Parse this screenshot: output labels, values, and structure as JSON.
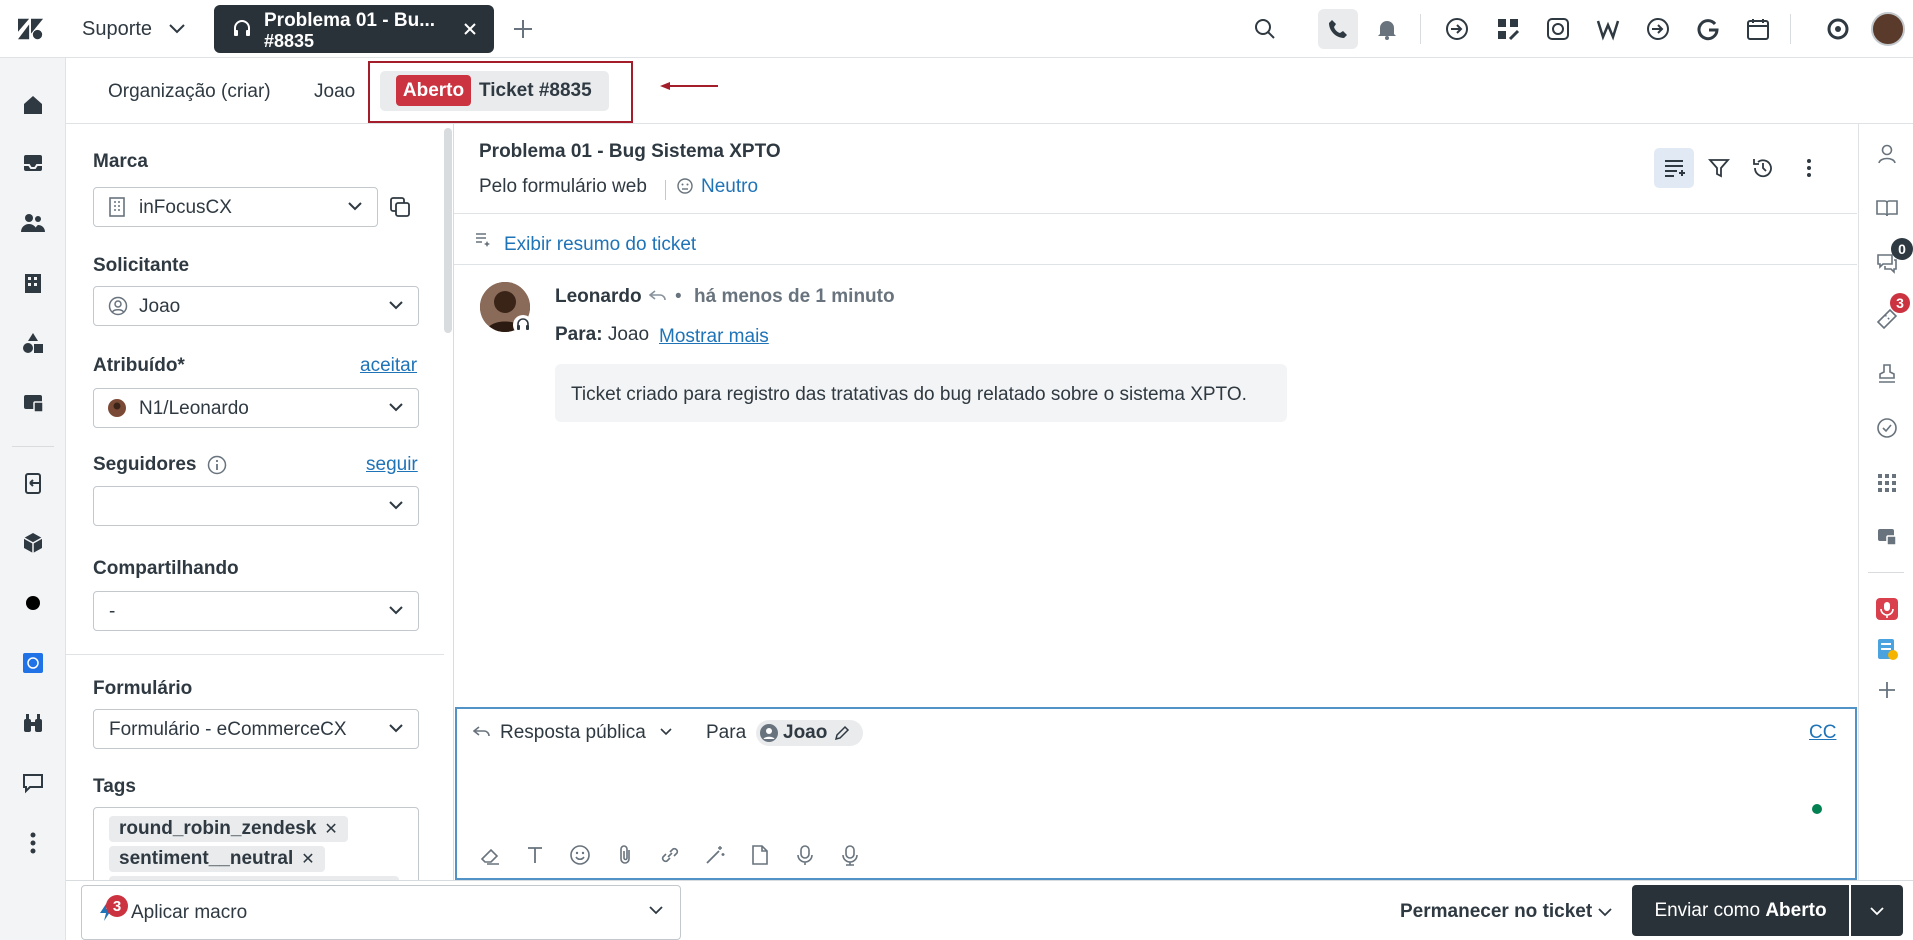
{
  "topbar": {
    "product": "Suporte",
    "tab_title": "Problema 01  - Bu...",
    "tab_subtitle": "#8835"
  },
  "context": {
    "org_link": "Organização (criar)",
    "user_link": "Joao",
    "status": "Aberto",
    "ticket_label": "Ticket #8835"
  },
  "fields": {
    "brand_label": "Marca",
    "brand_value": "inFocusCX",
    "requester_label": "Solicitante",
    "requester_value": "Joao",
    "assignee_label": "Atribuído*",
    "assignee_action": "aceitar",
    "assignee_value": "N1/Leonardo",
    "followers_label": "Seguidores",
    "followers_action": "seguir",
    "followers_value": "",
    "sharing_label": "Compartilhando",
    "sharing_value": "-",
    "form_label": "Formulário",
    "form_value": "Formulário - eCommerceCX",
    "tags_label": "Tags",
    "tags": [
      "round_robin_zendesk",
      "sentiment__neutral"
    ]
  },
  "conversation": {
    "title": "Problema 01  - Bug Sistema XPTO",
    "channel": "Pelo formulário web",
    "sentiment": "Neutro",
    "summary_link": "Exibir resumo do ticket",
    "message": {
      "author": "Leonardo",
      "time": "há menos de 1 minuto",
      "to_label": "Para:",
      "to_value": "Joao",
      "show_more": "Mostrar mais",
      "body": "Ticket criado para registro das tratativas do bug relatado sobre o sistema XPTO."
    }
  },
  "composer": {
    "reply_type": "Resposta pública",
    "to_label": "Para",
    "recipient": "Joao",
    "cc_label": "CC"
  },
  "rail": {
    "conversations_count": "0",
    "tickets_count": "3"
  },
  "footer": {
    "macro_badge": "3",
    "macro_label": "Aplicar macro",
    "stay_label": "Permanecer no ticket",
    "send_prefix": "Enviar como",
    "send_status": "Aberto"
  },
  "colors": {
    "status_open": "#cc3340",
    "link": "#1f73b7",
    "dark": "#293239",
    "focus": "#5293c7"
  }
}
